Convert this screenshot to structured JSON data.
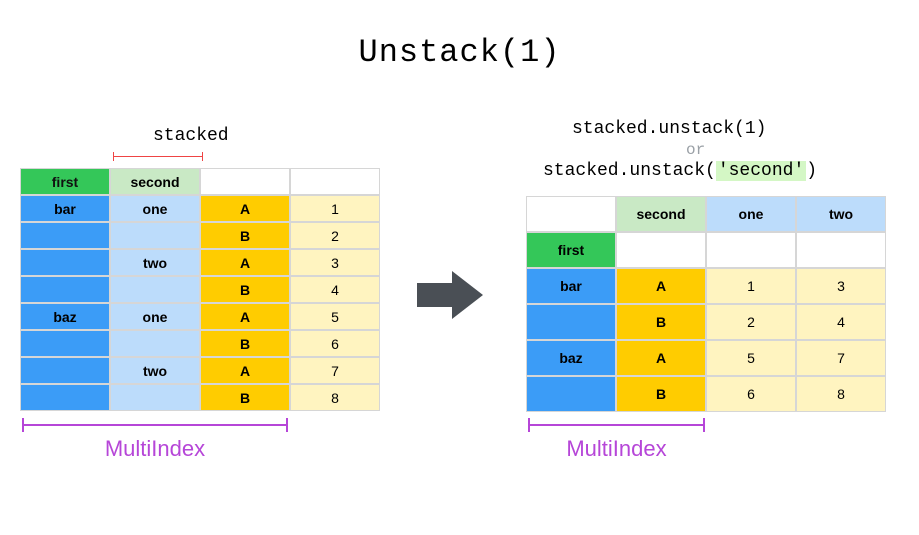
{
  "title": "Unstack(1)",
  "stacked_label": "stacked",
  "left": {
    "headers": {
      "first": "first",
      "second": "second"
    },
    "rows": [
      {
        "first": "bar",
        "second": "one",
        "ab": "A",
        "val": 1
      },
      {
        "first": "",
        "second": "",
        "ab": "B",
        "val": 2
      },
      {
        "first": "",
        "second": "two",
        "ab": "A",
        "val": 3
      },
      {
        "first": "",
        "second": "",
        "ab": "B",
        "val": 4
      },
      {
        "first": "baz",
        "second": "one",
        "ab": "A",
        "val": 5
      },
      {
        "first": "",
        "second": "",
        "ab": "B",
        "val": 6
      },
      {
        "first": "",
        "second": "two",
        "ab": "A",
        "val": 7
      },
      {
        "first": "",
        "second": "",
        "ab": "B",
        "val": 8
      }
    ]
  },
  "right_code": {
    "line1": "stacked.unstack(1)",
    "or": "or",
    "line2_pre": "stacked.unstack(",
    "line2_hl": "'second'",
    "line2_post": ")"
  },
  "right": {
    "second_hdr": "second",
    "col_hdrs": [
      "one",
      "two"
    ],
    "first_hdr": "first",
    "rows": [
      {
        "first": "bar",
        "ab": "A",
        "vals": [
          1,
          3
        ]
      },
      {
        "first": "",
        "ab": "B",
        "vals": [
          2,
          4
        ]
      },
      {
        "first": "baz",
        "ab": "A",
        "vals": [
          5,
          7
        ]
      },
      {
        "first": "",
        "ab": "B",
        "vals": [
          6,
          8
        ]
      }
    ]
  },
  "multiindex_label": "MultiIndex",
  "chart_data": {
    "type": "table",
    "title": "Unstack(1)",
    "description": "Pandas unstack operation moving MultiIndex level 'second' to columns",
    "stacked": {
      "index_levels": [
        "first",
        "second",
        ""
      ],
      "records": [
        [
          "bar",
          "one",
          "A",
          1
        ],
        [
          "bar",
          "one",
          "B",
          2
        ],
        [
          "bar",
          "two",
          "A",
          3
        ],
        [
          "bar",
          "two",
          "B",
          4
        ],
        [
          "baz",
          "one",
          "A",
          5
        ],
        [
          "baz",
          "one",
          "B",
          6
        ],
        [
          "baz",
          "two",
          "A",
          7
        ],
        [
          "baz",
          "two",
          "B",
          8
        ]
      ]
    },
    "unstacked": {
      "row_index_levels": [
        "first",
        ""
      ],
      "column_level_name": "second",
      "columns": [
        "one",
        "two"
      ],
      "records": [
        [
          "bar",
          "A",
          1,
          3
        ],
        [
          "bar",
          "B",
          2,
          4
        ],
        [
          "baz",
          "A",
          5,
          7
        ],
        [
          "baz",
          "B",
          6,
          8
        ]
      ]
    }
  }
}
